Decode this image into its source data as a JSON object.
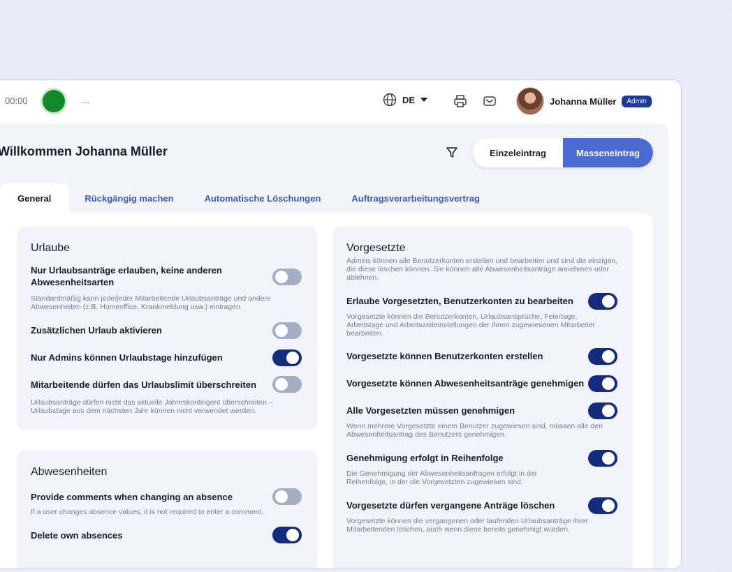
{
  "topbar": {
    "timer": "00:00",
    "more": "…",
    "language": "DE",
    "user_name": "Johanna Müller",
    "role_badge": "Admin"
  },
  "header": {
    "welcome": "Willkommen Johanna Müller",
    "single_entry": "Einzeleintrag",
    "bulk_entry": "Masseneintrag"
  },
  "tabs": [
    "General",
    "Rückgängig machen",
    "Automatische Löschungen",
    "Auftragsverarbeitungsvertrag"
  ],
  "urlaube": {
    "title": "Urlaube",
    "rows": [
      {
        "title": "Nur Urlaubsanträge erlauben, keine anderen Abwesenheitsarten",
        "desc": "Standardmäßig kann jede/jeder Mitarbeitende Urlaubsanträge und andere Abwesenheiten (z.B. Homeoffice, Krankmeldung usw.) eintragen.",
        "on": false
      },
      {
        "title": "Zusätzlichen Urlaub aktivieren",
        "desc": "",
        "on": false
      },
      {
        "title": "Nur Admins können Urlaubstage hinzufügen",
        "desc": "",
        "on": true
      },
      {
        "title": "Mitarbeitende dürfen das Urlaubslimit überschreiten",
        "desc": "Urlaubsanträge dürfen nicht das aktuelle Jahreskontingent überschreiten – Urlaubstage aus dem nächsten Jahr können nicht verwendet werden.",
        "on": false
      }
    ]
  },
  "abwesenheiten": {
    "title": "Abwesenheiten",
    "rows": [
      {
        "title": "Provide comments when changing an absence",
        "desc": "If a user changes absence values, it is not required to enter a comment.",
        "on": false
      },
      {
        "title": "Delete own absences",
        "desc": "",
        "on": true
      }
    ]
  },
  "vorgesetzte": {
    "title": "Vorgesetzte",
    "intro": "Admins können alle Benutzerkonten erstellen und bearbeiten und sind die einzigen, die diese löschen können. Sie können alle Abwesenheitsanträge annehmen oder ablehnen.",
    "rows": [
      {
        "title": "Erlaube Vorgesetzten, Benutzerkonten zu bearbeiten",
        "desc": "Vorgesetzte können die Benutzerkonten, Urlaubsansprüche, Feiertage, Arbeitstage und Arbeitszeiteinstellungen der ihnen zugewiesenen Mitarbeiter bearbeiten.",
        "on": true
      },
      {
        "title": "Vorgesetzte können Benutzerkonten erstellen",
        "desc": "",
        "on": true
      },
      {
        "title": "Vorgesetzte können Abwesenheitsanträge genehmigen",
        "desc": "",
        "on": true
      },
      {
        "title": "Alle Vorgesetzten müssen genehmigen",
        "desc": "Wenn mehrere Vorgesetzte einem Benutzer zugewiesen sind, müssen alle den Abwesenheitsantrag des Benutzers genehmigen.",
        "on": true
      },
      {
        "title": "Genehmigung erfolgt in Reihenfolge",
        "desc": "Die Genehmigung der Abwesenheitsanfragen erfolgt in der Reihenfolge, in der die Vorgesetzten zugewiesen sind.",
        "on": true
      },
      {
        "title": "Vorgesetzte dürfen vergangene Anträge löschen",
        "desc": "Vorgesetzte können die vergangenen oder laufenden Urlaubsanträge ihrer Mitarbeitenden löschen, auch wenn diese bereits genehmigt wurden.",
        "on": true
      }
    ]
  },
  "colors": {
    "accent": "#4b6bd2",
    "toggle_on": "#132c7e",
    "toggle_off": "#a3aec4",
    "rec": "#0f8a26"
  }
}
